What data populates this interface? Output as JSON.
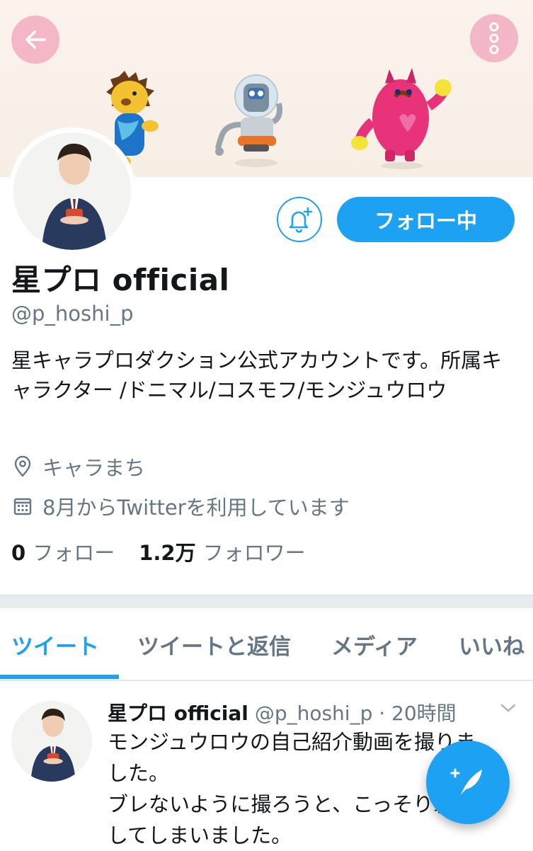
{
  "header": {
    "back_icon": "arrow-left-icon",
    "more_icon": "more-vertical-icon",
    "accent_pink": "#f4b7c8"
  },
  "profile": {
    "name": "星プロ official",
    "handle": "@p_hoshi_p",
    "bio": "星キャラプロダクション公式アカウントです。所属キャラクター /ドニマル/コスモフ/モンジュウロウ",
    "location": "キャラまち",
    "joined": "8月からTwitterを利用しています",
    "follow_button_label": "フォロー中",
    "following_count": "0",
    "following_label": "フォロー",
    "followers_count": "1.2万",
    "followers_label": "フォロワー"
  },
  "tabs": [
    {
      "label": "ツイート",
      "active": true
    },
    {
      "label": "ツイートと返信",
      "active": false
    },
    {
      "label": "メディア",
      "active": false
    },
    {
      "label": "いいね",
      "active": false
    }
  ],
  "tweet": {
    "name": "星プロ official",
    "meta": "@p_hoshi_p · 20時間",
    "line1": "モンジュウロウの自己紹介動画を撮りま",
    "line2": "した。",
    "line3": "ブレないように撮ろうと、こっそり裏",
    "line4": "してしまいました。"
  },
  "colors": {
    "accent": "#1da1f2",
    "muted": "#657786"
  }
}
